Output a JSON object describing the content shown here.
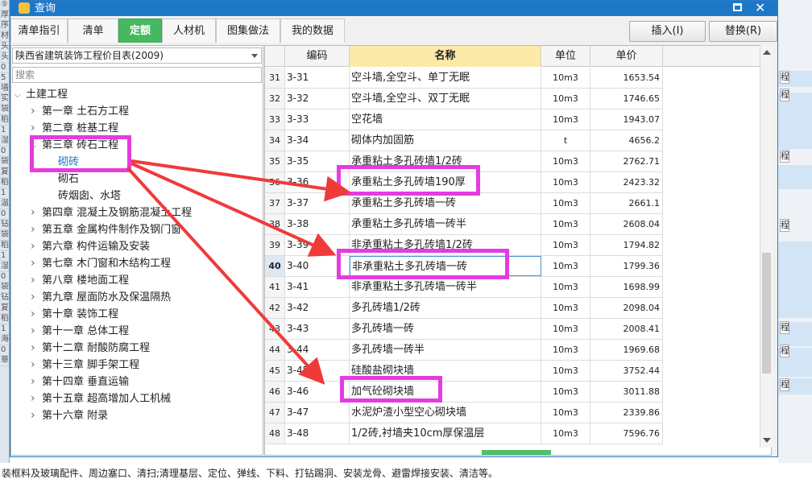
{
  "window": {
    "title": "查询"
  },
  "tabs": [
    {
      "label": "清单指引",
      "active": false
    },
    {
      "label": "清单",
      "active": false
    },
    {
      "label": "定额",
      "active": true
    },
    {
      "label": "人材机",
      "active": false
    },
    {
      "label": "图集做法",
      "active": false
    },
    {
      "label": "我的数据",
      "active": false
    }
  ],
  "buttons": {
    "insert": "插入(I)",
    "replace": "替换(R)"
  },
  "library": {
    "selected": "陕西省建筑装饰工程价目表(2009)"
  },
  "search": {
    "placeholder": "搜索"
  },
  "tree": [
    {
      "label": "土建工程",
      "level": 0,
      "expander": "expanded"
    },
    {
      "label": "第一章 土石方工程",
      "level": 1,
      "expander": "collapsed"
    },
    {
      "label": "第二章 桩基工程",
      "level": 1,
      "expander": "collapsed"
    },
    {
      "label": "第三章 砖石工程",
      "level": 1,
      "expander": "expanded"
    },
    {
      "label": "砌砖",
      "level": 2,
      "expander": "none",
      "selected": true
    },
    {
      "label": "砌石",
      "level": 2,
      "expander": "none"
    },
    {
      "label": "砖烟囱、水塔",
      "level": 2,
      "expander": "none"
    },
    {
      "label": "第四章 混凝土及钢筋混凝土工程",
      "level": 1,
      "expander": "collapsed"
    },
    {
      "label": "第五章 金属构件制作及钢门窗",
      "level": 1,
      "expander": "collapsed"
    },
    {
      "label": "第六章 构件运输及安装",
      "level": 1,
      "expander": "collapsed"
    },
    {
      "label": "第七章 木门窗和木结构工程",
      "level": 1,
      "expander": "collapsed"
    },
    {
      "label": "第八章 楼地面工程",
      "level": 1,
      "expander": "collapsed"
    },
    {
      "label": "第九章 屋面防水及保温隔热",
      "level": 1,
      "expander": "collapsed"
    },
    {
      "label": "第十章 装饰工程",
      "level": 1,
      "expander": "collapsed"
    },
    {
      "label": "第十一章 总体工程",
      "level": 1,
      "expander": "collapsed"
    },
    {
      "label": "第十二章 耐酸防腐工程",
      "level": 1,
      "expander": "collapsed"
    },
    {
      "label": "第十三章 脚手架工程",
      "level": 1,
      "expander": "collapsed"
    },
    {
      "label": "第十四章 垂直运输",
      "level": 1,
      "expander": "collapsed"
    },
    {
      "label": "第十五章 超高增加人工机械",
      "level": 1,
      "expander": "collapsed"
    },
    {
      "label": "第十六章 附录",
      "level": 1,
      "expander": "collapsed"
    }
  ],
  "grid": {
    "columns": [
      "",
      "编码",
      "名称",
      "单位",
      "单价"
    ],
    "current_row": "40",
    "rows": [
      {
        "no": "31",
        "code": "3-31",
        "name": "空斗墙,全空斗、单丁无眠",
        "unit": "10m3",
        "price": "1653.54"
      },
      {
        "no": "32",
        "code": "3-32",
        "name": "空斗墙,全空斗、双丁无眠",
        "unit": "10m3",
        "price": "1746.65"
      },
      {
        "no": "33",
        "code": "3-33",
        "name": "空花墙",
        "unit": "10m3",
        "price": "1943.07"
      },
      {
        "no": "34",
        "code": "3-34",
        "name": "砌体内加固筋",
        "unit": "t",
        "price": "4656.2"
      },
      {
        "no": "35",
        "code": "3-35",
        "name": "承重粘土多孔砖墙1/2砖",
        "unit": "10m3",
        "price": "2762.71"
      },
      {
        "no": "36",
        "code": "3-36",
        "name": "承重粘土多孔砖墙190厚",
        "unit": "10m3",
        "price": "2423.32"
      },
      {
        "no": "37",
        "code": "3-37",
        "name": "承重粘土多孔砖墙一砖",
        "unit": "10m3",
        "price": "2661.1"
      },
      {
        "no": "38",
        "code": "3-38",
        "name": "承重粘土多孔砖墙一砖半",
        "unit": "10m3",
        "price": "2608.04"
      },
      {
        "no": "39",
        "code": "3-39",
        "name": "非承重粘土多孔砖墙1/2砖",
        "unit": "10m3",
        "price": "1794.82"
      },
      {
        "no": "40",
        "code": "3-40",
        "name": "非承重粘土多孔砖墙一砖",
        "unit": "10m3",
        "price": "1799.36"
      },
      {
        "no": "41",
        "code": "3-41",
        "name": "非承重粘土多孔砖墙一砖半",
        "unit": "10m3",
        "price": "1698.99"
      },
      {
        "no": "42",
        "code": "3-42",
        "name": "多孔砖墙1/2砖",
        "unit": "10m3",
        "price": "2098.04"
      },
      {
        "no": "43",
        "code": "3-43",
        "name": "多孔砖墙一砖",
        "unit": "10m3",
        "price": "2008.41"
      },
      {
        "no": "44",
        "code": "3-44",
        "name": "多孔砖墙一砖半",
        "unit": "10m3",
        "price": "1969.68"
      },
      {
        "no": "45",
        "code": "3-45",
        "name": "硅酸盐砌块墙",
        "unit": "10m3",
        "price": "3752.44"
      },
      {
        "no": "46",
        "code": "3-46",
        "name": "加气砼砌块墙",
        "unit": "10m3",
        "price": "3011.88"
      },
      {
        "no": "47",
        "code": "3-47",
        "name": "水泥炉渣小型空心砌块墙",
        "unit": "10m3",
        "price": "2339.86"
      },
      {
        "no": "48",
        "code": "3-48",
        "name": "1/2砖,衬墙夹10cm厚保温层",
        "unit": "10m3",
        "price": "7596.76"
      }
    ]
  },
  "footnote": "装框料及玻璃配件、周边塞口、清扫;清理基层、定位、弹线、下料、打钻踢洞、安装龙骨、避雷焊接安装、清洁等。",
  "background_left_text": [
    "⑤",
    "厚",
    "序",
    "材",
    "头",
    "头",
    "0",
    "5",
    "墙",
    "实",
    "袋",
    "稻",
    "1",
    "湿",
    "0",
    "袋",
    "复",
    "稻",
    "1",
    "温",
    "0",
    "钻",
    "袋",
    "稻",
    "1",
    "湿",
    "0",
    "袋",
    "钻",
    "复",
    "稻",
    "1",
    "海",
    "0",
    "章"
  ],
  "background_right_text": [
    "程",
    "程",
    "程",
    "程",
    "程",
    "程",
    "程"
  ],
  "colors": {
    "titlebar": "#1e78c8",
    "active_tab": "#46b860",
    "annotation": "#e53be0",
    "arrow": "#f03a3a"
  }
}
